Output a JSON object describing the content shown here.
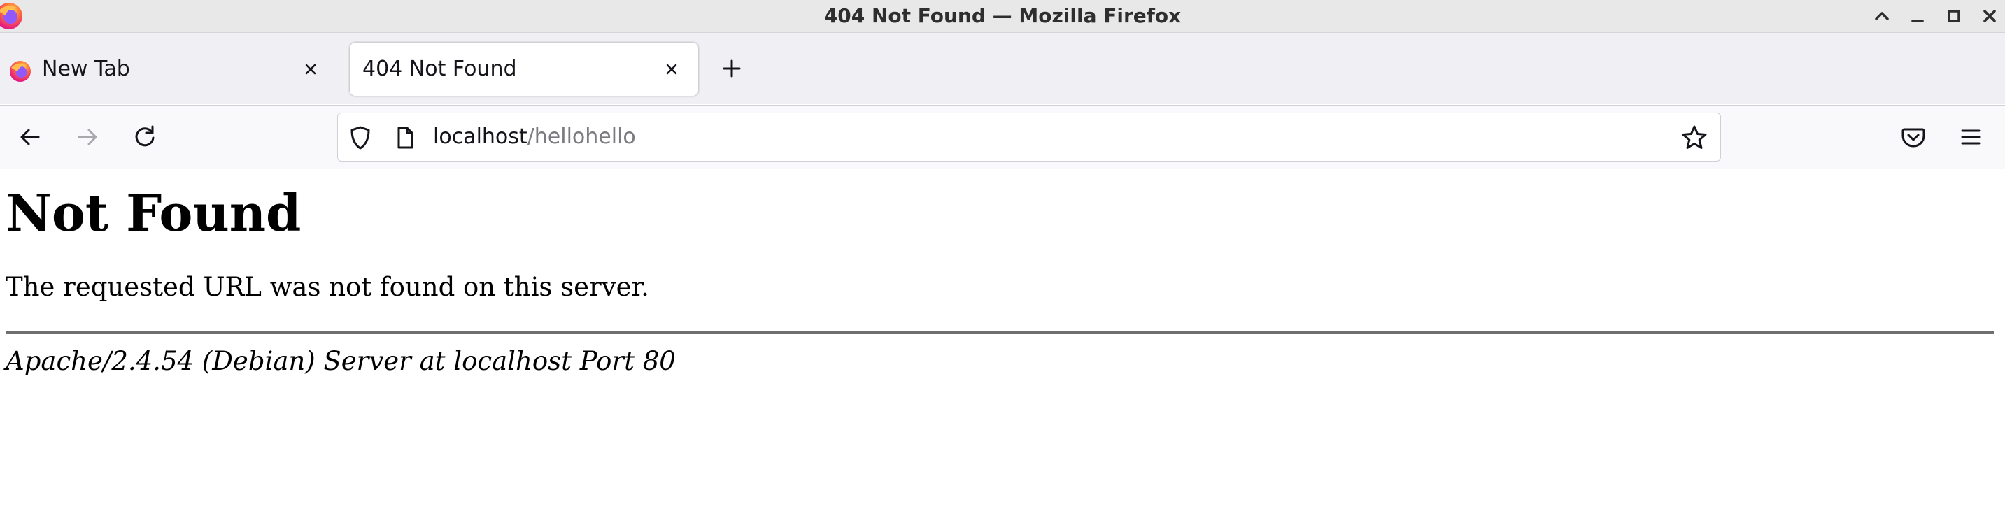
{
  "window": {
    "title": "404 Not Found — Mozilla Firefox",
    "controls": [
      "chevron-up-icon",
      "minimize-icon",
      "maximize-icon",
      "close-icon"
    ]
  },
  "tabs": [
    {
      "label": "New Tab",
      "icon": "firefox-icon",
      "active": false
    },
    {
      "label": "404 Not Found",
      "active": true
    }
  ],
  "toolbar": {
    "url_host": "localhost",
    "url_path": "/hellohello",
    "icons": [
      "back-icon",
      "forward-icon",
      "reload-icon",
      "shield-icon",
      "page-icon",
      "star-icon",
      "pocket-icon",
      "menu-icon"
    ]
  },
  "page": {
    "heading": "Not Found",
    "message": "The requested URL was not found on this server.",
    "signature": "Apache/2.4.54 (Debian) Server at localhost Port 80"
  },
  "colors": {
    "titlebar": "#e9e8e8",
    "tabstrip": "#f0f0f4",
    "navbar": "#f9f9fb",
    "url_path": "#7a7a80",
    "firefox_orange": "#ff7139",
    "firefox_purple": "#9059ff"
  }
}
